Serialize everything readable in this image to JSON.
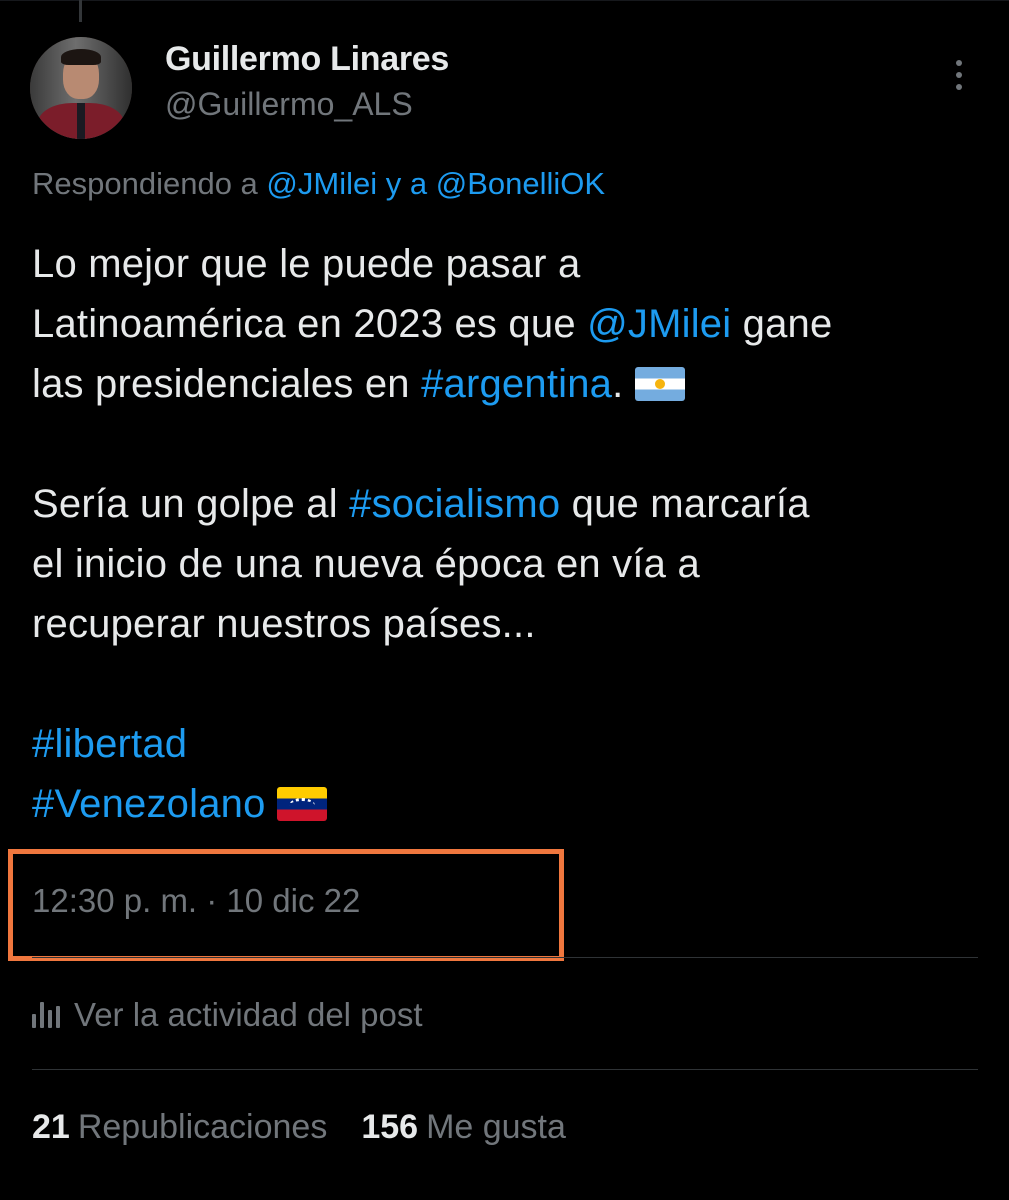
{
  "author": {
    "name": "Guillermo Linares",
    "handle": "@Guillermo_ALS"
  },
  "reply_context": {
    "prefix": "Respondiendo a",
    "mention_1": "@JMilei",
    "conjunction": "y a",
    "mention_2": "@BonelliOK"
  },
  "tweet": {
    "line1": "Lo mejor que le puede pasar a",
    "line2_pre": "Latinoamérica en 2023 es que ",
    "line2_mention": "@JMilei",
    "line2_post": " gane",
    "line3_pre": "las presidenciales en ",
    "line3_hashtag": "#argentina",
    "line3_post": ".",
    "line4_pre": "Sería un golpe al ",
    "line4_hashtag": "#socialismo",
    "line4_post": " que marcaría",
    "line5": "el inicio de una nueva época en vía a",
    "line6": "recuperar nuestros países...",
    "hashtag_1": "#libertad",
    "hashtag_2": "#Venezolano",
    "flag_1_icon": "argentina-flag-icon",
    "flag_2_icon": "venezuela-flag-icon"
  },
  "timestamp": "12:30 p. m. · 10 dic 22",
  "activity": {
    "icon": "analytics-bars-icon",
    "label": "Ver la actividad del post"
  },
  "stats": {
    "reposts_count": "21",
    "reposts_label": "Republicaciones",
    "likes_count": "156",
    "likes_label": "Me gusta"
  },
  "colors": {
    "background": "#000000",
    "text_primary": "#e7e9ea",
    "text_secondary": "#71767b",
    "link": "#1d9bf0",
    "highlight_box": "#f0773e"
  }
}
